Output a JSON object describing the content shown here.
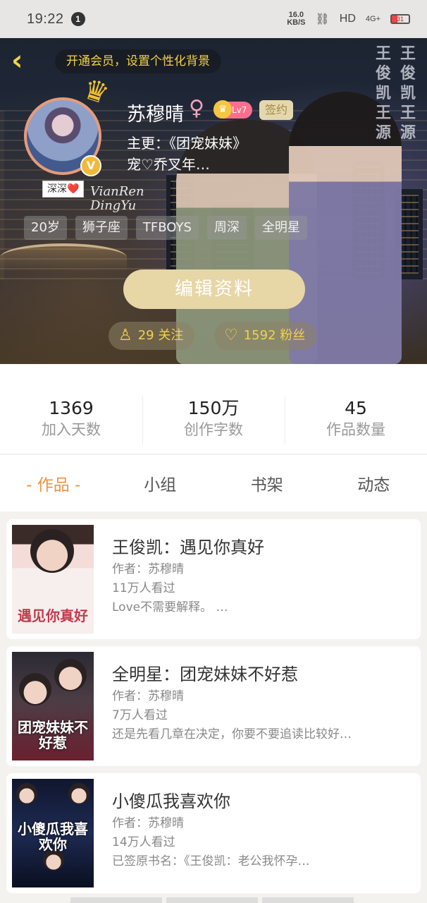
{
  "status_bar": {
    "time": "19:22",
    "notification_count": "1",
    "speed_value": "16.0",
    "speed_unit": "KB/S",
    "hd": "HD",
    "network": "4G+",
    "battery": "31"
  },
  "header": {
    "vip_banner": "开通会员，设置个性化背景",
    "username": "苏穆晴",
    "gender_icon": "♀",
    "level": "Lv7",
    "sign_badge": "签约",
    "main_work": "主更：《团宠妹妹》",
    "bio": "宠♡乔叉年…",
    "sticker_text": "深深❤️",
    "signature": "VianRen DingYu",
    "vertical_left": "王俊凯王源",
    "vertical_right": "王俊凯王源",
    "tags": [
      "20岁",
      "狮子座",
      "TFBOYS",
      "周深",
      "全明星"
    ],
    "edit_button": "编辑资料",
    "following": "29 关注",
    "fans": "1592 粉丝"
  },
  "stats": [
    {
      "value": "1369",
      "label": "加入天数"
    },
    {
      "value": "150万",
      "label": "创作字数"
    },
    {
      "value": "45",
      "label": "作品数量"
    }
  ],
  "tabs": [
    "- 作品 -",
    "小组",
    "书架",
    "动态"
  ],
  "works": [
    {
      "title": "王俊凯：遇见你真好",
      "author": "作者：苏穆晴",
      "views": "11万人看过",
      "desc": "Love不需要解释。      …",
      "cover_text": "遇见你真好"
    },
    {
      "title": "全明星：团宠妹妹不好惹",
      "author": "作者：苏穆晴",
      "views": "7万人看过",
      "desc": "还是先看几章在决定，你要不要追读比较好…",
      "cover_text": "团宠妹妹不好惹"
    },
    {
      "title": "小傻瓜我喜欢你",
      "author": "作者：苏穆晴",
      "views": "14万人看过",
      "desc": "已签原书名：《王俊凯：老公我怀孕…",
      "cover_text": "小傻瓜我喜欢你"
    }
  ],
  "colors": {
    "accent": "#f2913f",
    "gold": "#f2d24a",
    "edit_button_bg": "#e7d6a6"
  },
  "icons": {
    "back": "chevron-left-icon",
    "crown": "crown-icon",
    "verified": "v-badge-icon",
    "follow": "add-user-icon",
    "fans": "heart-icon"
  }
}
